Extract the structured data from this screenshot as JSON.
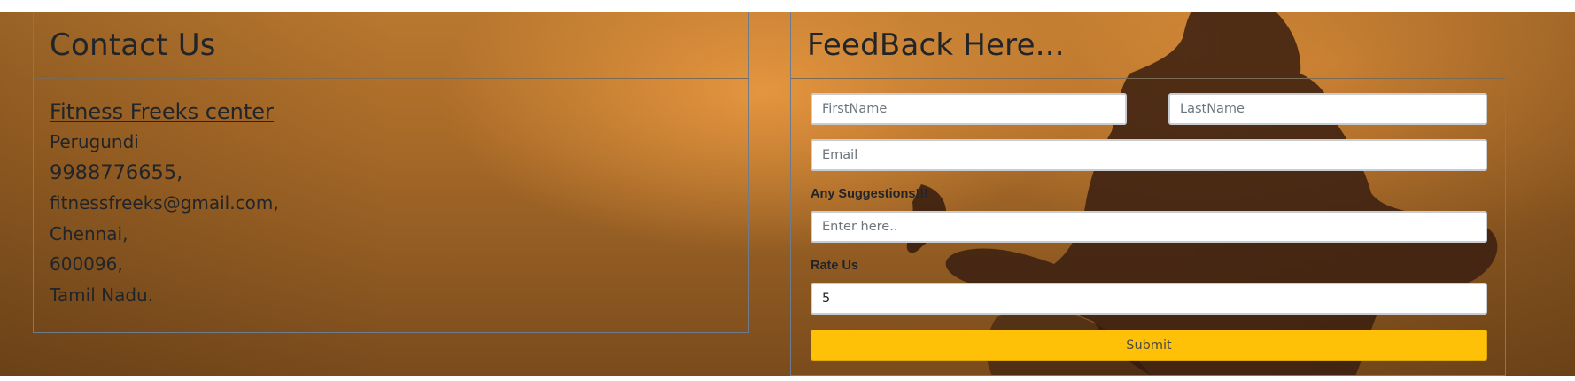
{
  "contact": {
    "title": "Contact Us",
    "center_name": "Fitness Freeks center",
    "area": "Perugundi",
    "phone": "9988776655,",
    "email": "fitnessfreeks@gmail.com,",
    "city": "Chennai,",
    "pincode": "600096,",
    "state": "Tamil Nadu."
  },
  "feedback": {
    "title": "FeedBack Here...",
    "first_name_placeholder": "FirstName",
    "last_name_placeholder": "LastName",
    "email_placeholder": "Email",
    "suggestions_label": "Any Suggestions!!!",
    "suggestions_placeholder": "Enter here..",
    "rate_label": "Rate Us",
    "rate_value": "5",
    "submit_label": "Submit"
  },
  "colors": {
    "submit_button": "#ffc107",
    "text": "#212529",
    "panel_border": "#6e7b8c"
  }
}
